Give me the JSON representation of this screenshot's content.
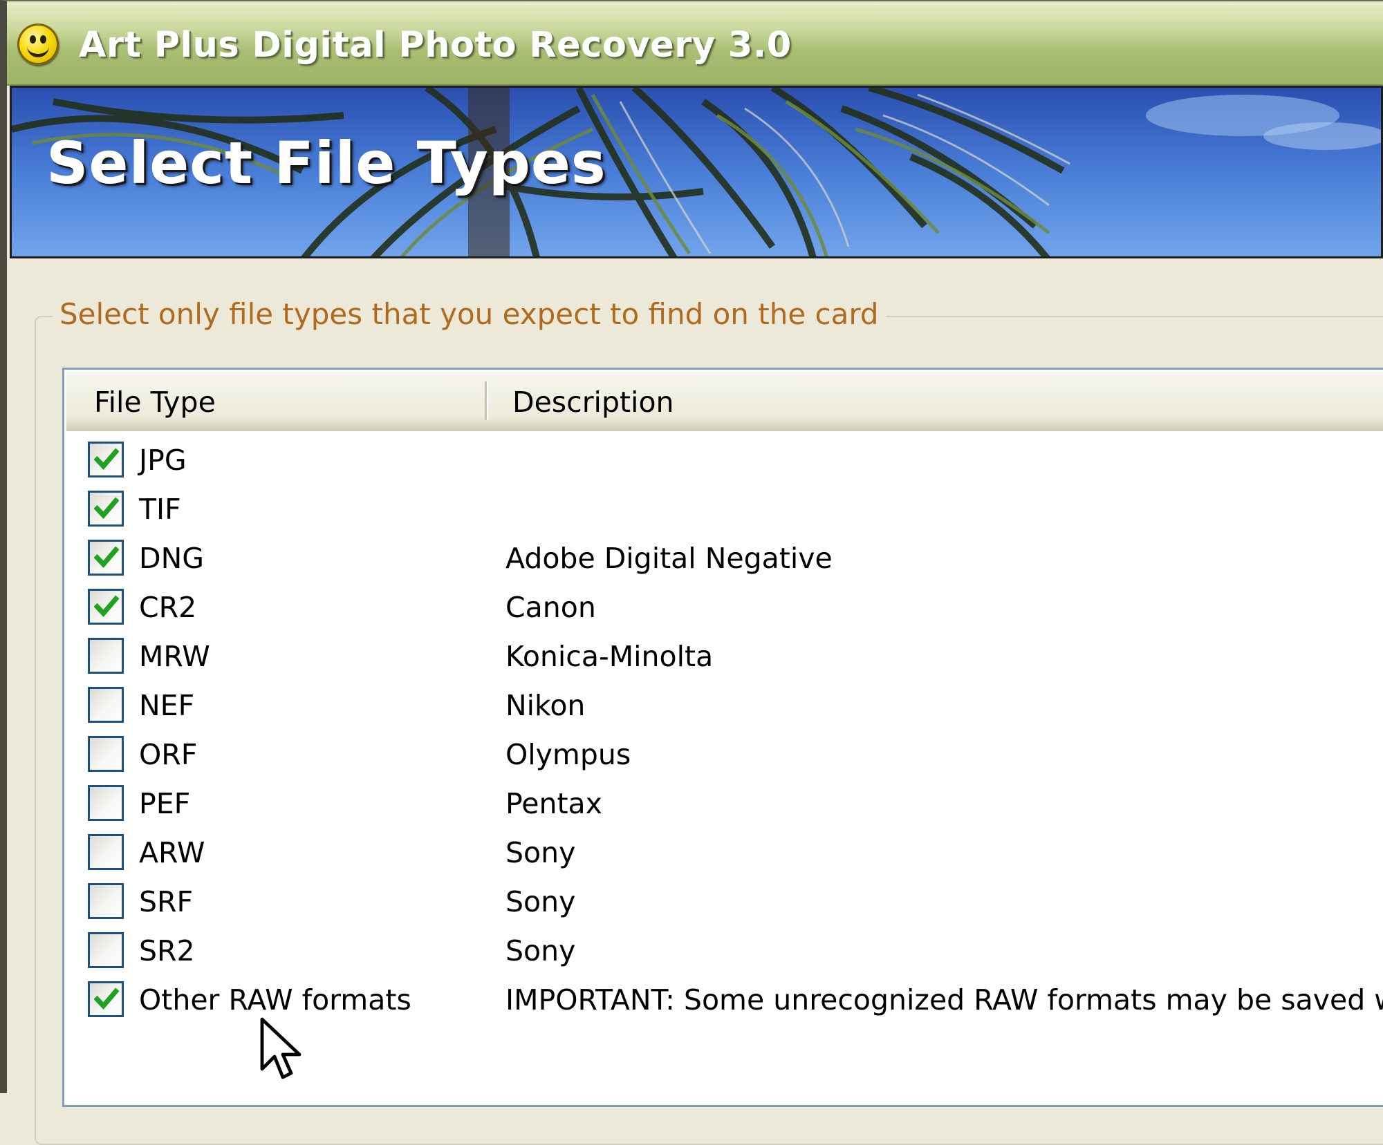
{
  "window": {
    "title": "Art Plus Digital Photo Recovery 3.0",
    "app_icon": "smiley-face-icon"
  },
  "banner": {
    "title": "Select File Types"
  },
  "group": {
    "label": "Select only file types that you expect to find on the card"
  },
  "list": {
    "columns": [
      "File Type",
      "Description"
    ],
    "rows": [
      {
        "type": "JPG",
        "description": "",
        "checked": true
      },
      {
        "type": "TIF",
        "description": "",
        "checked": true
      },
      {
        "type": "DNG",
        "description": "Adobe Digital Negative",
        "checked": true
      },
      {
        "type": "CR2",
        "description": "Canon",
        "checked": true
      },
      {
        "type": "MRW",
        "description": "Konica-Minolta",
        "checked": false
      },
      {
        "type": "NEF",
        "description": "Nikon",
        "checked": false
      },
      {
        "type": "ORF",
        "description": "Olympus",
        "checked": false
      },
      {
        "type": "PEF",
        "description": "Pentax",
        "checked": false
      },
      {
        "type": "ARW",
        "description": "Sony",
        "checked": false
      },
      {
        "type": "SRF",
        "description": "Sony",
        "checked": false
      },
      {
        "type": "SR2",
        "description": "Sony",
        "checked": false
      },
      {
        "type": "Other RAW formats",
        "description": "IMPORTANT: Some unrecognized RAW formats may be saved w",
        "checked": true
      }
    ]
  },
  "colors": {
    "title_bar": "#a9bd73",
    "group_label": "#b06a1e",
    "checkbox_border": "#1c5180",
    "check_mark": "#21a121",
    "banner_sky": "#3f6fd0"
  }
}
